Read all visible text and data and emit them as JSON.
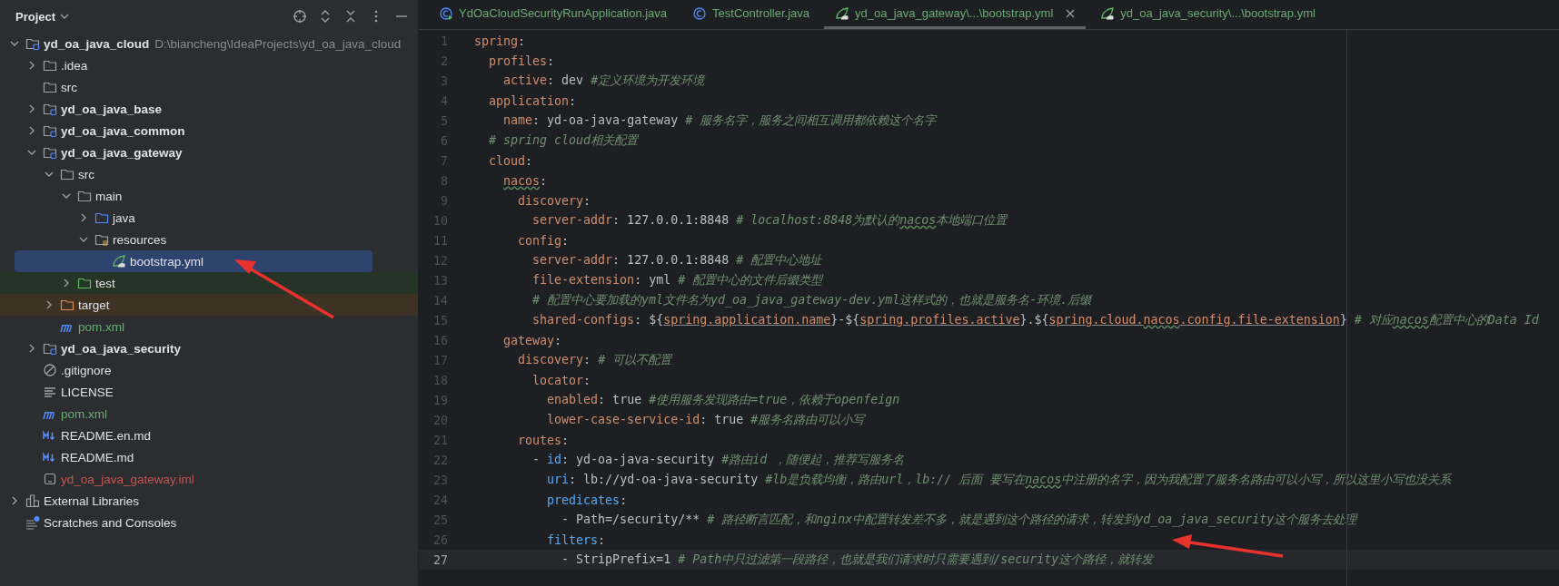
{
  "project_panel": {
    "title": "Project",
    "tree": [
      {
        "label": "yd_oa_java_cloud",
        "hint": "D:\\biancheng\\IdeaProjects\\yd_oa_java_cloud",
        "kind": "module",
        "expanded": true,
        "selected": false,
        "children": [
          {
            "label": ".idea",
            "kind": "folder",
            "expanded": false,
            "selected": false
          },
          {
            "label": "src",
            "kind": "folder",
            "selected": false
          },
          {
            "label": "yd_oa_java_base",
            "kind": "module",
            "expanded": false,
            "selected": false
          },
          {
            "label": "yd_oa_java_common",
            "kind": "module",
            "expanded": false,
            "selected": false
          },
          {
            "label": "yd_oa_java_gateway",
            "kind": "module",
            "expanded": true,
            "selected": false,
            "children": [
              {
                "label": "src",
                "kind": "folder",
                "expanded": true,
                "selected": false,
                "children": [
                  {
                    "label": "main",
                    "kind": "folder",
                    "expanded": true,
                    "selected": false,
                    "children": [
                      {
                        "label": "java",
                        "kind": "source-folder",
                        "expanded": false,
                        "selected": false
                      },
                      {
                        "label": "resources",
                        "kind": "resource-folder",
                        "expanded": true,
                        "selected": false,
                        "children": [
                          {
                            "label": "bootstrap.yml",
                            "kind": "yml",
                            "selected": true
                          }
                        ]
                      }
                    ]
                  },
                  {
                    "label": "test",
                    "kind": "test-folder",
                    "expanded": false,
                    "selected": false
                  }
                ]
              },
              {
                "label": "target",
                "kind": "excluded-folder",
                "expanded": false,
                "selected": false
              },
              {
                "label": "pom.xml",
                "kind": "maven",
                "color": "#6aab73",
                "selected": false
              }
            ]
          },
          {
            "label": "yd_oa_java_security",
            "kind": "module",
            "expanded": false,
            "selected": false
          },
          {
            "label": ".gitignore",
            "kind": "ignore",
            "selected": false
          },
          {
            "label": "LICENSE",
            "kind": "text",
            "selected": false
          },
          {
            "label": "pom.xml",
            "kind": "maven",
            "color": "#6aab73",
            "selected": false
          },
          {
            "label": "README.en.md",
            "kind": "markdown",
            "selected": false
          },
          {
            "label": "README.md",
            "kind": "markdown",
            "selected": false
          },
          {
            "label": "yd_oa_java_gateway.iml",
            "kind": "iml",
            "color": "#c75450",
            "selected": false
          }
        ]
      },
      {
        "label": "External Libraries",
        "kind": "libraries",
        "expanded": false,
        "selected": false
      },
      {
        "label": "Scratches and Consoles",
        "kind": "scratches",
        "selected": false
      }
    ]
  },
  "tabs": [
    {
      "label": "YdOaCloudSecurityRunApplication.java",
      "kind": "run-class",
      "selected": false
    },
    {
      "label": "TestController.java",
      "kind": "class",
      "selected": false
    },
    {
      "label": "yd_oa_java_gateway\\...\\bootstrap.yml",
      "kind": "yml",
      "selected": true
    },
    {
      "label": "yd_oa_java_security\\...\\bootstrap.yml",
      "kind": "yml",
      "selected": false
    }
  ],
  "editor": {
    "lines": [
      {
        "number": "1",
        "current": false,
        "tokens": [
          {
            "kind": "key",
            "text": "spring"
          },
          {
            "kind": "plain",
            "text": ":"
          }
        ]
      },
      {
        "number": "2",
        "current": false,
        "tokens": [
          {
            "kind": "key",
            "text": "  profiles"
          },
          {
            "kind": "plain",
            "text": ":"
          }
        ]
      },
      {
        "number": "3",
        "current": false,
        "tokens": [
          {
            "kind": "key",
            "text": "    active"
          },
          {
            "kind": "plain",
            "text": ": dev "
          },
          {
            "kind": "comment",
            "text": "#定义环境为开发环境"
          }
        ]
      },
      {
        "number": "4",
        "current": false,
        "tokens": [
          {
            "kind": "key",
            "text": "  application"
          },
          {
            "kind": "plain",
            "text": ":"
          }
        ]
      },
      {
        "number": "5",
        "current": false,
        "tokens": [
          {
            "kind": "key",
            "text": "    name"
          },
          {
            "kind": "plain",
            "text": ": yd-oa-java-gateway "
          },
          {
            "kind": "comment",
            "text": "# 服务名字，服务之间相互调用都依赖这个名字"
          }
        ]
      },
      {
        "number": "6",
        "current": false,
        "tokens": [
          {
            "kind": "comment",
            "text": "  # spring cloud相关配置"
          }
        ]
      },
      {
        "number": "7",
        "current": false,
        "tokens": [
          {
            "kind": "key",
            "text": "  cloud"
          },
          {
            "kind": "plain",
            "text": ":"
          }
        ]
      },
      {
        "number": "8",
        "current": false,
        "tokens": [
          {
            "kind": "key",
            "text": "    nacos",
            "typo": true
          },
          {
            "kind": "plain",
            "text": ":"
          }
        ]
      },
      {
        "number": "9",
        "current": false,
        "tokens": [
          {
            "kind": "key",
            "text": "      discovery"
          },
          {
            "kind": "plain",
            "text": ":"
          }
        ]
      },
      {
        "number": "10",
        "current": false,
        "tokens": [
          {
            "kind": "key",
            "text": "        server-addr"
          },
          {
            "kind": "plain",
            "text": ": 127.0.0.1:8848 "
          },
          {
            "kind": "comment",
            "text": "# localhost:8848为默认的"
          },
          {
            "kind": "comment",
            "text": "nacos",
            "typo": true
          },
          {
            "kind": "comment",
            "text": "本地端口位置"
          }
        ]
      },
      {
        "number": "11",
        "current": false,
        "tokens": [
          {
            "kind": "key",
            "text": "      config"
          },
          {
            "kind": "plain",
            "text": ":"
          }
        ]
      },
      {
        "number": "12",
        "current": false,
        "tokens": [
          {
            "kind": "key",
            "text": "        server-addr"
          },
          {
            "kind": "plain",
            "text": ": 127.0.0.1:8848 "
          },
          {
            "kind": "comment",
            "text": "# 配置中心地址"
          }
        ]
      },
      {
        "number": "13",
        "current": false,
        "tokens": [
          {
            "kind": "key",
            "text": "        file-extension"
          },
          {
            "kind": "plain",
            "text": ": yml "
          },
          {
            "kind": "comment",
            "text": "# 配置中心的文件后缀类型"
          }
        ]
      },
      {
        "number": "14",
        "current": false,
        "tokens": [
          {
            "kind": "comment",
            "text": "        # 配置中心要加载的yml文件名为yd_oa_java_gateway-dev.yml这样式的，也就是服务名-环境.后缀"
          }
        ]
      },
      {
        "number": "15",
        "current": false,
        "tokens": [
          {
            "kind": "key",
            "text": "        shared-configs"
          },
          {
            "kind": "plain",
            "text": ": ${"
          },
          {
            "kind": "ref",
            "text": "spring.application.name"
          },
          {
            "kind": "plain",
            "text": "}-${"
          },
          {
            "kind": "ref",
            "text": "spring.profiles.active"
          },
          {
            "kind": "plain",
            "text": "}.${"
          },
          {
            "kind": "ref",
            "text": "spring.cloud."
          },
          {
            "kind": "ref",
            "text": "nacos",
            "typo": true
          },
          {
            "kind": "ref",
            "text": ".config.file-extension"
          },
          {
            "kind": "plain",
            "text": "} "
          },
          {
            "kind": "comment",
            "text": "# 对应"
          },
          {
            "kind": "comment",
            "text": "nacos",
            "typo": true
          },
          {
            "kind": "comment",
            "text": "配置中心的Data Id"
          }
        ]
      },
      {
        "number": "16",
        "current": false,
        "tokens": [
          {
            "kind": "key",
            "text": "    gateway"
          },
          {
            "kind": "plain",
            "text": ":"
          }
        ]
      },
      {
        "number": "17",
        "current": false,
        "tokens": [
          {
            "kind": "key",
            "text": "      discovery"
          },
          {
            "kind": "plain",
            "text": ": "
          },
          {
            "kind": "comment",
            "text": "# 可以不配置"
          }
        ]
      },
      {
        "number": "18",
        "current": false,
        "tokens": [
          {
            "kind": "key",
            "text": "        locator"
          },
          {
            "kind": "plain",
            "text": ":"
          }
        ]
      },
      {
        "number": "19",
        "current": false,
        "tokens": [
          {
            "kind": "key",
            "text": "          enabled"
          },
          {
            "kind": "plain",
            "text": ": true "
          },
          {
            "kind": "comment",
            "text": "#使用服务发现路由=true，依赖于openfeign"
          }
        ]
      },
      {
        "number": "20",
        "current": false,
        "tokens": [
          {
            "kind": "key",
            "text": "          lower-case-service-id"
          },
          {
            "kind": "plain",
            "text": ": true "
          },
          {
            "kind": "comment",
            "text": "#服务名路由可以小写"
          }
        ]
      },
      {
        "number": "21",
        "current": false,
        "tokens": [
          {
            "kind": "key",
            "text": "      routes"
          },
          {
            "kind": "plain",
            "text": ":"
          }
        ]
      },
      {
        "number": "22",
        "current": false,
        "tokens": [
          {
            "kind": "plain",
            "text": "        - "
          },
          {
            "kind": "special-key",
            "text": "id"
          },
          {
            "kind": "plain",
            "text": ": yd-oa-java-security "
          },
          {
            "kind": "comment",
            "text": "#路由id ，随便起，推荐写服务名"
          }
        ]
      },
      {
        "number": "23",
        "current": false,
        "tokens": [
          {
            "kind": "special-key",
            "text": "          uri"
          },
          {
            "kind": "plain",
            "text": ": lb://yd-oa-java-security "
          },
          {
            "kind": "comment",
            "text": "#lb是负载均衡，路由url，lb:// 后面 要写在"
          },
          {
            "kind": "comment",
            "text": "nacos",
            "typo": true
          },
          {
            "kind": "comment",
            "text": "中注册的名字，因为我配置了服务名路由可以小写，所以这里小写也没关系"
          }
        ]
      },
      {
        "number": "24",
        "current": false,
        "tokens": [
          {
            "kind": "special-key",
            "text": "          predicates"
          },
          {
            "kind": "plain",
            "text": ":"
          }
        ]
      },
      {
        "number": "25",
        "current": false,
        "tokens": [
          {
            "kind": "plain",
            "text": "            - Path=/security/** "
          },
          {
            "kind": "comment",
            "text": "# 路径断言匹配，和nginx中配置转发差不多，就是遇到这个路径的请求，转发到yd_oa_java_security这个服务去处理"
          }
        ]
      },
      {
        "number": "26",
        "current": false,
        "tokens": [
          {
            "kind": "special-key",
            "text": "          filters"
          },
          {
            "kind": "plain",
            "text": ":"
          }
        ]
      },
      {
        "number": "27",
        "current": true,
        "tokens": [
          {
            "kind": "plain",
            "text": "            - StripPrefix=1 "
          },
          {
            "kind": "comment",
            "text": "# Path中只过滤第一段路径，也就是我们请求时只需要遇到/security这个路径，就转发"
          }
        ]
      }
    ]
  }
}
